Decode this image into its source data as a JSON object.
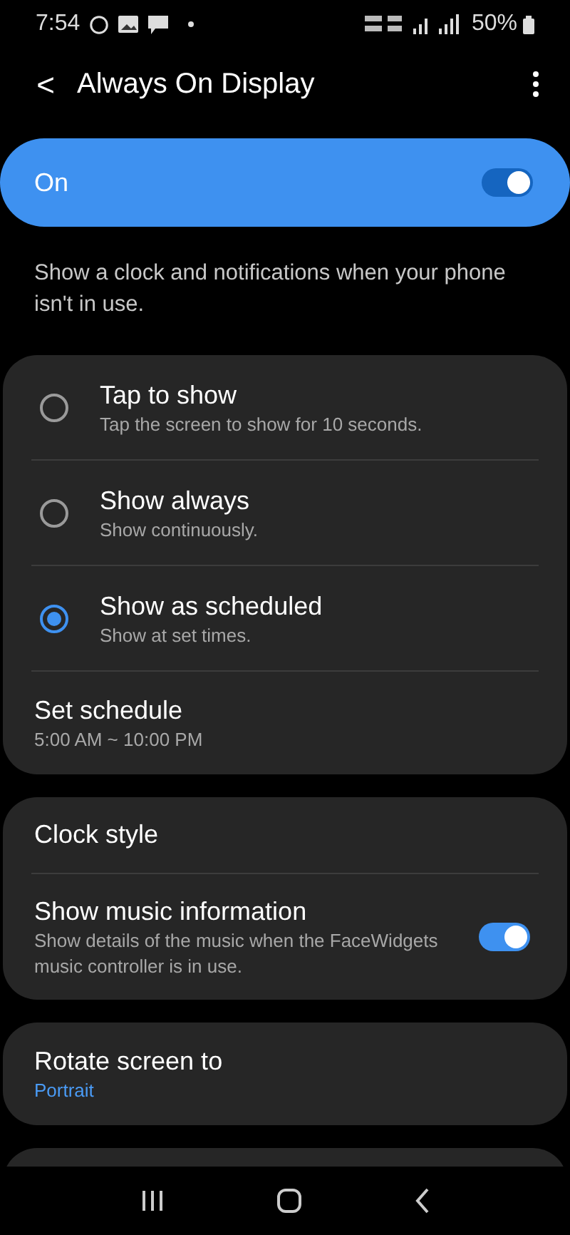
{
  "status_bar": {
    "time": "7:54",
    "battery": "50%"
  },
  "header": {
    "back": "<",
    "title": "Always On Display"
  },
  "master_switch": {
    "label": "On",
    "on": true
  },
  "description": "Show a clock and notifications when your phone isn't in use.",
  "display_modes": [
    {
      "title": "Tap to show",
      "subtitle": "Tap the screen to show for 10 seconds.",
      "selected": false
    },
    {
      "title": "Show always",
      "subtitle": "Show continuously.",
      "selected": false
    },
    {
      "title": "Show as scheduled",
      "subtitle": "Show at set times.",
      "selected": true
    }
  ],
  "schedule": {
    "title": "Set schedule",
    "value": "5:00 AM ~ 10:00 PM"
  },
  "style_settings": [
    {
      "kind": "link",
      "title": "Clock style"
    },
    {
      "kind": "toggle",
      "title": "Show music information",
      "subtitle": "Show details of the music when the FaceWidgets music controller is in use.",
      "on": true
    }
  ],
  "rotate": {
    "title": "Rotate screen to",
    "value": "Portrait"
  }
}
